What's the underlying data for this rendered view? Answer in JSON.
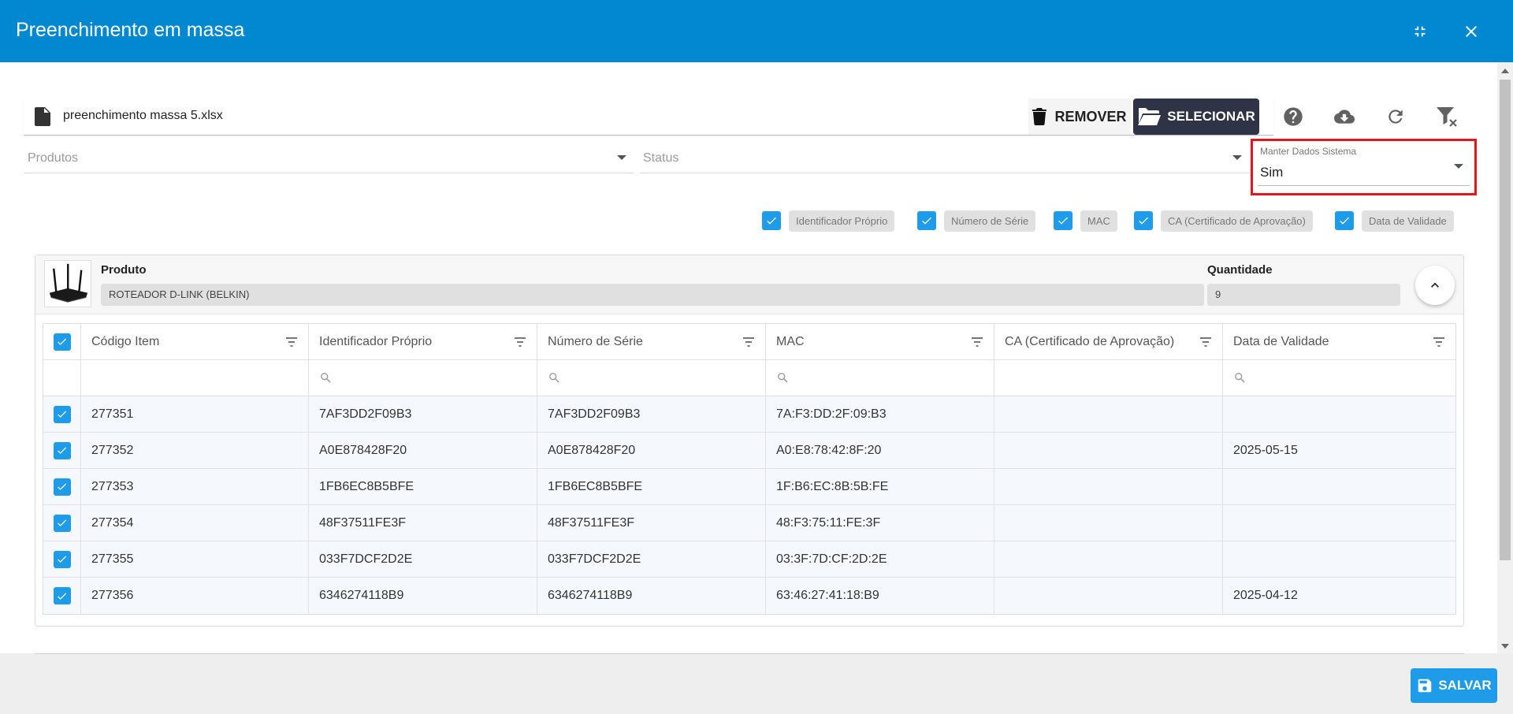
{
  "window": {
    "title": "Preenchimento em massa",
    "minimize_icon": "collapse-icon",
    "close_icon": "close-icon"
  },
  "file": {
    "name": "preenchimento massa 5.xlsx",
    "remove_label": "REMOVER",
    "select_label": "SELECIONAR"
  },
  "toolbar": {
    "help_icon": "help-icon",
    "download_icon": "cloud-download-icon",
    "refresh_icon": "refresh-icon",
    "clear_filter_icon": "filter-clear-icon"
  },
  "filters": {
    "produtos_placeholder": "Produtos",
    "status_placeholder": "Status",
    "manter_label": "Manter Dados Sistema",
    "manter_value": "Sim"
  },
  "column_toggles": [
    {
      "label": "Identificador Próprio",
      "checked": true
    },
    {
      "label": "Número de Série",
      "checked": true
    },
    {
      "label": "MAC",
      "checked": true
    },
    {
      "label": "CA (Certificado de Aprovação)",
      "checked": true
    },
    {
      "label": "Data de Validade",
      "checked": true
    }
  ],
  "product": {
    "title": "Produto",
    "name": "ROTEADOR D-LINK (BELKIN)",
    "quantity_title": "Quantidade",
    "quantity": "9"
  },
  "grid": {
    "columns": [
      "Código Item",
      "Identificador Próprio",
      "Número de Série",
      "MAC",
      "CA (Certificado de Aprovação)",
      "Data de Validade"
    ],
    "rows": [
      {
        "codigo": "277351",
        "identificador": "7AF3DD2F09B3",
        "serie": "7AF3DD2F09B3",
        "mac": "7A:F3:DD:2F:09:B3",
        "ca": "",
        "validade": ""
      },
      {
        "codigo": "277352",
        "identificador": "A0E878428F20",
        "serie": "A0E878428F20",
        "mac": "A0:E8:78:42:8F:20",
        "ca": "",
        "validade": "2025-05-15"
      },
      {
        "codigo": "277353",
        "identificador": "1FB6EC8B5BFE",
        "serie": "1FB6EC8B5BFE",
        "mac": "1F:B6:EC:8B:5B:FE",
        "ca": "",
        "validade": ""
      },
      {
        "codigo": "277354",
        "identificador": "48F37511FE3F",
        "serie": "48F37511FE3F",
        "mac": "48:F3:75:11:FE:3F",
        "ca": "",
        "validade": ""
      },
      {
        "codigo": "277355",
        "identificador": "033F7DCF2D2E",
        "serie": "033F7DCF2D2E",
        "mac": "03:3F:7D:CF:2D:2E",
        "ca": "",
        "validade": ""
      },
      {
        "codigo": "277356",
        "identificador": "6346274118B9",
        "serie": "6346274118B9",
        "mac": "63:46:27:41:18:B9",
        "ca": "",
        "validade": "2025-04-12"
      }
    ]
  },
  "footer": {
    "save_label": "SALVAR"
  },
  "colors": {
    "header": "#0288d1",
    "accent": "#1e9cea",
    "dark_button": "#2e3446",
    "highlight_border": "#e8141b"
  }
}
